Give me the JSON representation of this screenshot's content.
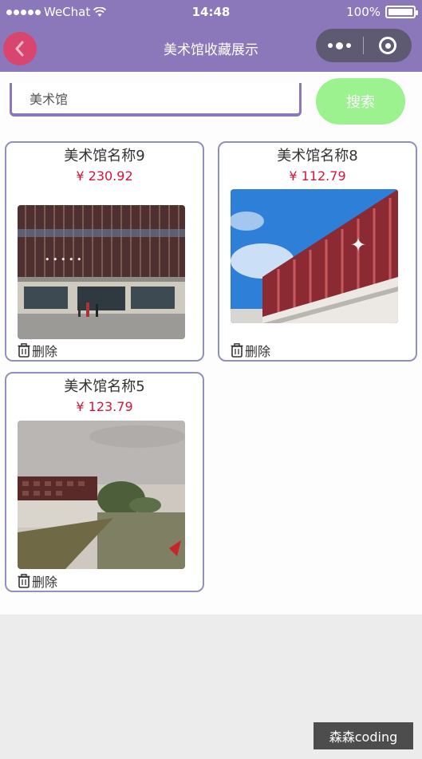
{
  "status_bar": {
    "carrier": "WeChat",
    "time": "14:48",
    "battery": "100%"
  },
  "nav": {
    "title": "美术馆收藏展示",
    "back_icon": "chevron-left-icon",
    "more_icon": "more-dots-icon",
    "close_icon": "target-circle-icon"
  },
  "search": {
    "value": "美术馆",
    "button_label": "搜索"
  },
  "cards": [
    {
      "name": "美术馆名称9",
      "price": "¥ 230.92",
      "delete_label": "删除"
    },
    {
      "name": "美术馆名称8",
      "price": "¥ 112.79",
      "delete_label": "删除"
    },
    {
      "name": "美术馆名称5",
      "price": "¥ 123.79",
      "delete_label": "删除"
    }
  ],
  "watermark": "森森coding",
  "colors": {
    "nav": "#8a78bb",
    "search_button": "#9bf28f",
    "price": "#d6153a",
    "back_button": "#d8456e"
  }
}
